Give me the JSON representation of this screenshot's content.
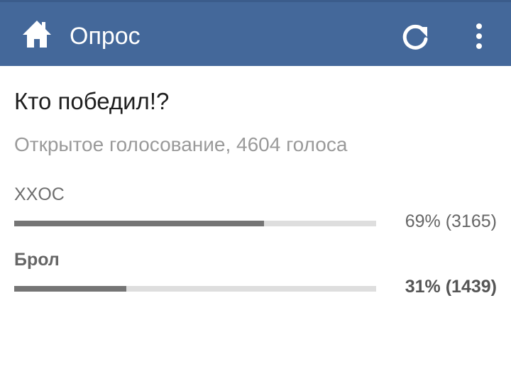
{
  "header": {
    "title": "Опрос",
    "background_color": "#44689a",
    "home_icon": "home-icon",
    "refresh_icon": "refresh-icon",
    "menu_icon": "more-vertical-icon"
  },
  "poll": {
    "question": "Кто победил!?",
    "meta": "Открытое голосование, 4604 голоса",
    "options": [
      {
        "label": "XXOC",
        "percent": 69,
        "result_text": "69% (3165)",
        "selected": false
      },
      {
        "label": "Брол",
        "percent": 31,
        "result_text": "31% (1439)",
        "selected": true
      }
    ]
  }
}
